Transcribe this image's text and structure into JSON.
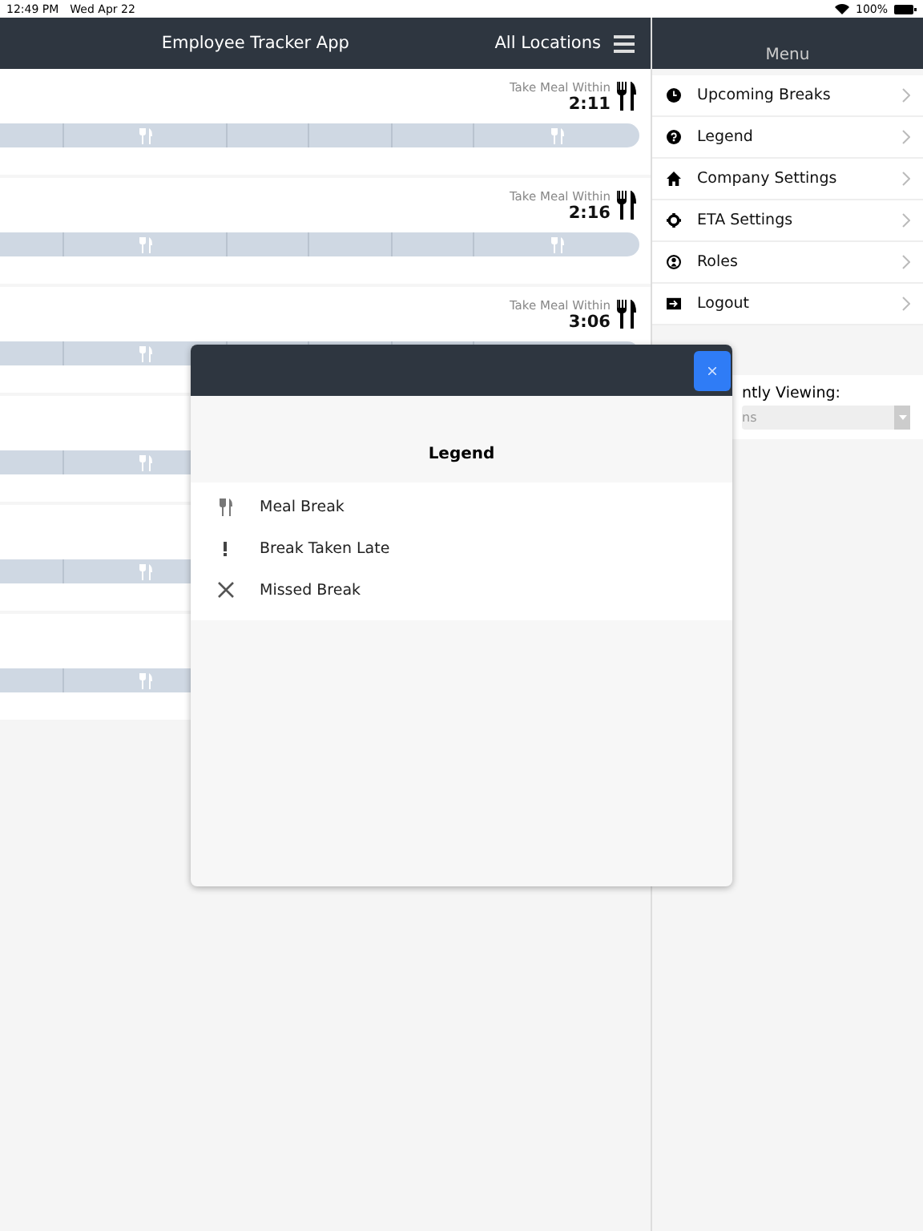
{
  "status_bar": {
    "time": "12:49 PM",
    "date": "Wed Apr 22",
    "battery": "100%"
  },
  "header": {
    "title": "Employee Tracker App",
    "location": "All Locations"
  },
  "employees": [
    {
      "kind": "countdown",
      "meal_label": "Take Meal Within",
      "meal_time": "2:11"
    },
    {
      "kind": "countdown",
      "meal_label": "Take Meal Within",
      "meal_time": "2:16"
    },
    {
      "kind": "countdown",
      "meal_label": "Take Meal Within",
      "meal_time": "3:06"
    },
    {
      "kind": "timeline"
    },
    {
      "kind": "timeline"
    },
    {
      "kind": "timeline"
    }
  ],
  "menu": {
    "title": "Menu",
    "items": [
      {
        "label": "Upcoming Breaks",
        "kind": "clock"
      },
      {
        "label": "Legend",
        "kind": "help"
      },
      {
        "label": "Company Settings",
        "kind": "home"
      },
      {
        "label": "ETA Settings",
        "kind": "gear"
      },
      {
        "label": "Roles",
        "kind": "person"
      },
      {
        "label": "Logout",
        "kind": "logout"
      }
    ]
  },
  "viewing": {
    "label": "ntly Viewing:",
    "value": "ns"
  },
  "modal": {
    "title": "Legend",
    "items": [
      {
        "label": "Meal Break",
        "kind": "meal"
      },
      {
        "label": "Break Taken Late",
        "kind": "late"
      },
      {
        "label": "Missed Break",
        "kind": "missed"
      }
    ]
  }
}
